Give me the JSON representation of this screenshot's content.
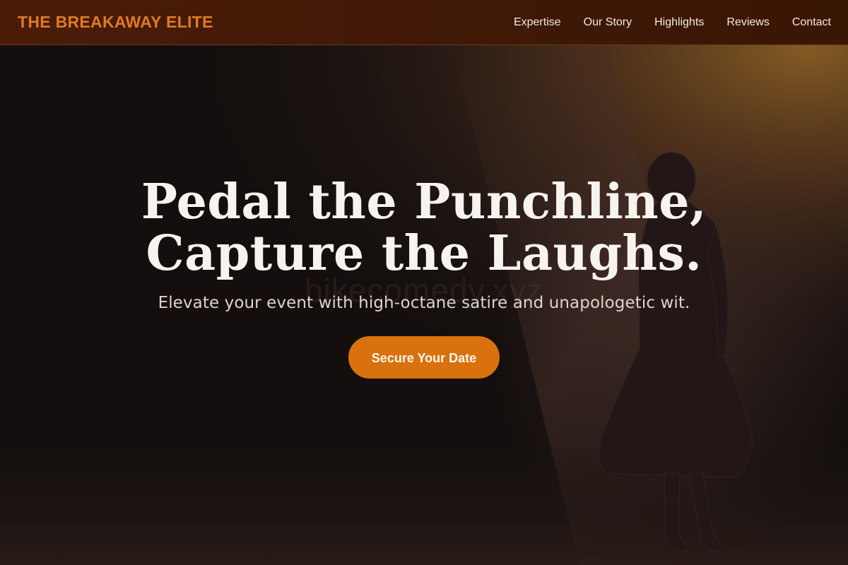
{
  "brand": {
    "name": "THE BREAKAWAY ELITE"
  },
  "nav": {
    "links": [
      "Expertise",
      "Our Story",
      "Highlights",
      "Reviews",
      "Contact"
    ]
  },
  "hero": {
    "title_line1": "Pedal the Punchline,",
    "title_line2": "Capture the Laughs.",
    "subtitle": "Elevate your event with high-octane satire and unapologetic wit.",
    "cta_label": "Secure Your Date",
    "watermark": "bikecomedy.xyz",
    "image": "stage-performer-spotlight"
  },
  "colors": {
    "accent": "#d9720e",
    "brand_text": "#e07b22",
    "nav_bg": "#4a1c08",
    "hero_bg": "#161110"
  }
}
